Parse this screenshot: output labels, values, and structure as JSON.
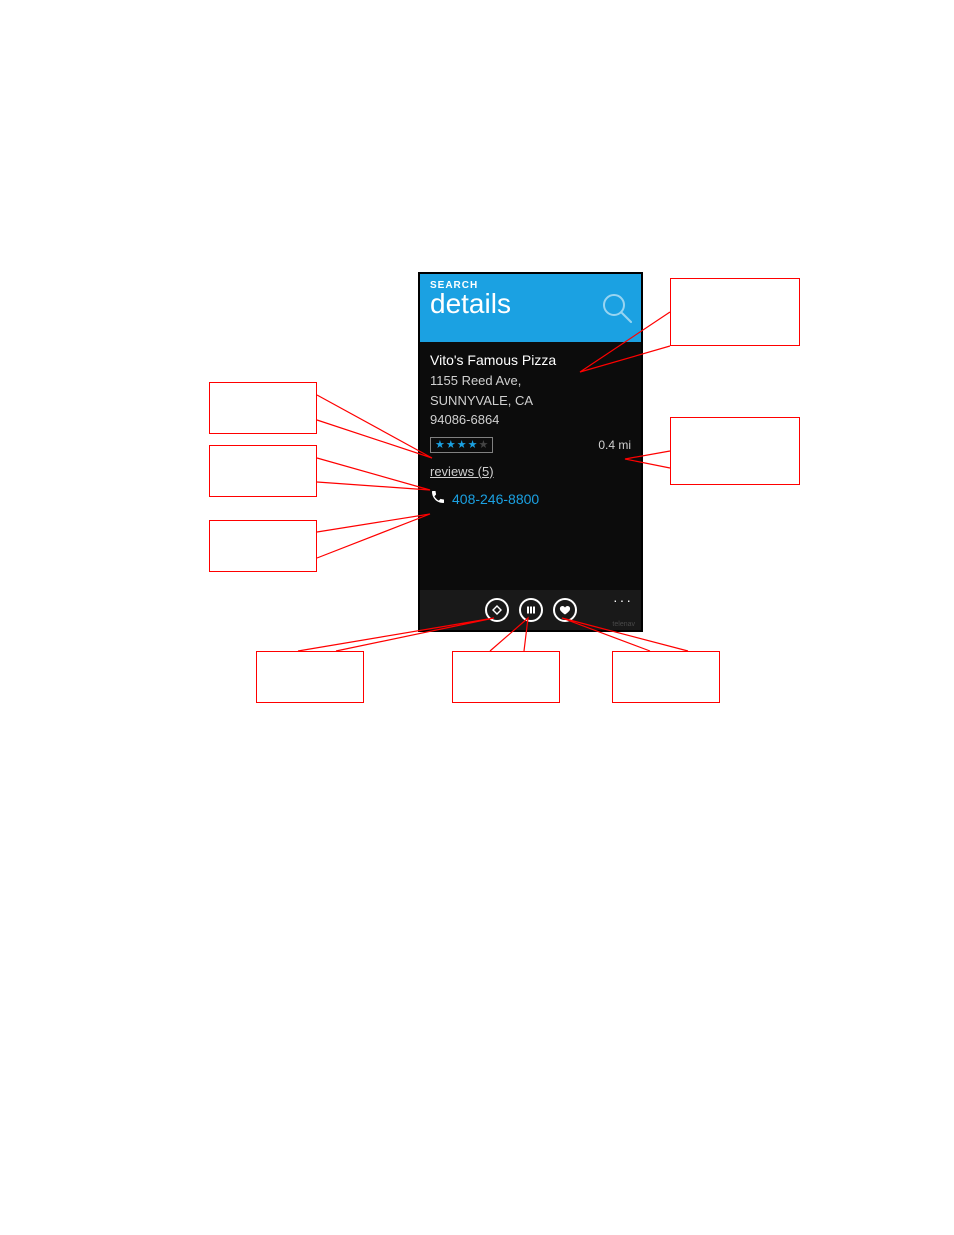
{
  "header": {
    "app_label": "SEARCH",
    "page_title": "details"
  },
  "details": {
    "name": "Vito's Famous Pizza",
    "address_line1": "1155 Reed Ave,",
    "address_line2": "SUNNYVALE, CA",
    "postal": "94086-6864",
    "distance": "0.4 mi",
    "reviews_label": "reviews (5)",
    "phone": "408-246-8800",
    "rating_icons": {
      "filled": "★",
      "dim": "★"
    }
  },
  "appbar": {
    "ellipsis": "···",
    "brand": "telenav"
  },
  "colors": {
    "accent": "#1ba1e2",
    "callout_border": "#ff0000",
    "phone_bg": "#0c0c0c"
  }
}
